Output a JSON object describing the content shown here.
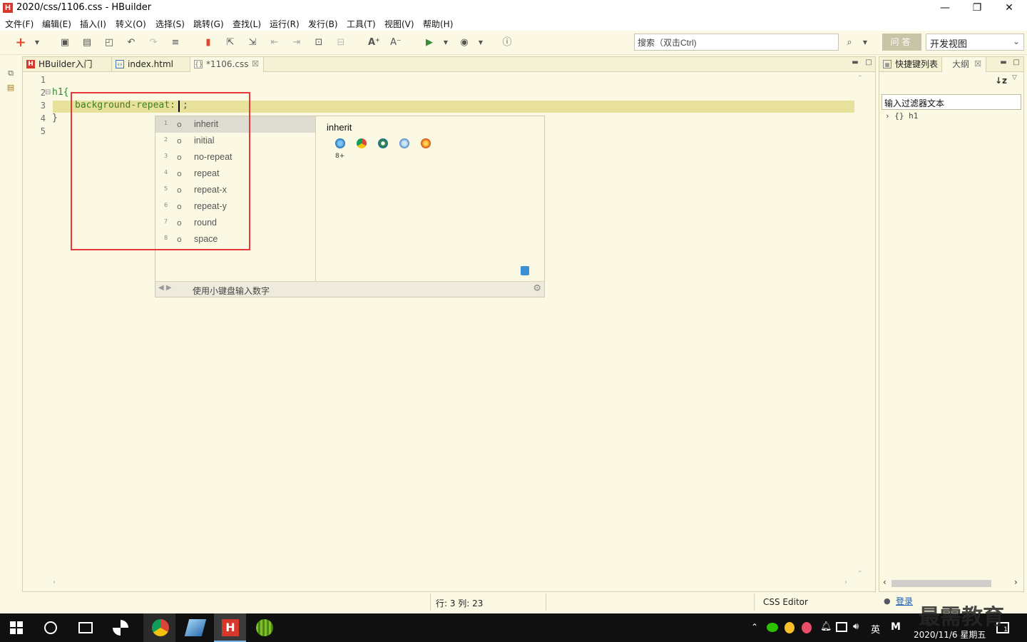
{
  "window": {
    "logo": "H",
    "title": "2020/css/1106.css  -  HBuilder",
    "min": "—",
    "max": "❐",
    "close": "✕"
  },
  "menu": [
    "文件(F)",
    "编辑(E)",
    "插入(I)",
    "转义(O)",
    "选择(S)",
    "跳转(G)",
    "查找(L)",
    "运行(R)",
    "发行(B)",
    "工具(T)",
    "视图(V)",
    "帮助(H)"
  ],
  "toolbar": {
    "search_placeholder": "搜索（双击Ctrl)",
    "qa_label": "问答",
    "view_mode": "开发视图"
  },
  "editor_tabs": [
    {
      "label": "HBuilder入门",
      "icon": "H"
    },
    {
      "label": "index.html",
      "icon": "‹›"
    },
    {
      "label": "*1106.css",
      "icon": "{}",
      "close": "☒"
    }
  ],
  "code": {
    "lines": [
      "1",
      "2",
      "3",
      "4",
      "5"
    ],
    "fold_marker": "⊟",
    "line2": "h1{",
    "line3_prop": "background-repeat:",
    "line3_end": ";",
    "line4": "}"
  },
  "autocomplete": {
    "items": [
      {
        "idx": "1",
        "dot": "o",
        "label": "inherit"
      },
      {
        "idx": "2",
        "dot": "o",
        "label": "initial"
      },
      {
        "idx": "3",
        "dot": "o",
        "label": "no-repeat"
      },
      {
        "idx": "4",
        "dot": "o",
        "label": "repeat"
      },
      {
        "idx": "5",
        "dot": "o",
        "label": "repeat-x"
      },
      {
        "idx": "6",
        "dot": "o",
        "label": "repeat-y"
      },
      {
        "idx": "7",
        "dot": "o",
        "label": "round"
      },
      {
        "idx": "8",
        "dot": "o",
        "label": "space"
      }
    ],
    "selected_index": 0,
    "detail_title": "inherit",
    "ie_version": "8+",
    "browser_icons": [
      "ie-icon",
      "chrome-icon",
      "android-icon",
      "safari-icon",
      "firefox-icon"
    ],
    "footer_arrows": "◀ ▶",
    "footer_hint": "使用小键盘输入数字",
    "footer_gear": "⚙"
  },
  "right_panel": {
    "tabs": [
      {
        "label": "快捷键列表"
      },
      {
        "label": "大纲",
        "close": "☒"
      }
    ],
    "sort_icon": "↓z",
    "filter_value": "输入过滤器文本",
    "outline_item": "›  {} h1"
  },
  "status": {
    "position": "行: 3 列: 23",
    "editor_type": "CSS Editor",
    "login": "登录"
  },
  "taskbar": {
    "ime": "英",
    "ime2": "M",
    "date": "2020/11/6 星期五",
    "watermark": "最需教育",
    "notify_count": "1"
  },
  "colors": {
    "accent_red": "#e63a3a",
    "editor_bg": "#fbf9e3",
    "current_line": "#e8e19b",
    "code_blue": "#1b5fa8",
    "selector_green": "#2e8a2e"
  }
}
